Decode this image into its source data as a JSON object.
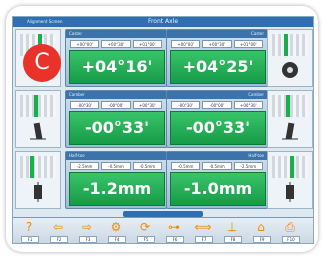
{
  "badge": "C",
  "titlebar": {
    "left_text": "Alignment Screen",
    "title": "Front Axle"
  },
  "rows": [
    {
      "name": "caster",
      "left": {
        "label": "Caster",
        "ticks": [
          "+00°00'",
          "+00°30'",
          "+01°00'"
        ],
        "value": "+04°16'"
      },
      "right": {
        "label": "Caster",
        "ticks": [
          "+00°00'",
          "+00°30'",
          "+01°00'"
        ],
        "value": "+04°25'"
      }
    },
    {
      "name": "camber",
      "left": {
        "label": "Camber",
        "ticks": [
          "-00°30'",
          "-00°00'",
          "+00°30'"
        ],
        "value": "-00°33'"
      },
      "right": {
        "label": "Camber",
        "ticks": [
          "-00°30'",
          "-00°00'",
          "+00°30'"
        ],
        "value": "-00°33'"
      }
    },
    {
      "name": "toe",
      "left": {
        "label": "Half-toe",
        "ticks": [
          "-2.5mm",
          "-0.5mm",
          "-0.5mm"
        ],
        "value": "-1.2mm"
      },
      "right": {
        "label": "Half-toe",
        "ticks": [
          "-0.5mm",
          "-0.5mm",
          "-2.5mm"
        ],
        "value": "-1.0mm"
      }
    }
  ],
  "toolbar": {
    "strip_label": "",
    "buttons": [
      {
        "name": "help",
        "glyph": "?",
        "key": "F1"
      },
      {
        "name": "back",
        "glyph": "⇦",
        "key": "F2"
      },
      {
        "name": "forward",
        "glyph": "⇨",
        "key": "F3"
      },
      {
        "name": "steering",
        "glyph": "⚙",
        "key": "F4"
      },
      {
        "name": "caster-sweep",
        "glyph": "⟳",
        "key": "F5"
      },
      {
        "name": "axle",
        "glyph": "⊶",
        "key": "F6"
      },
      {
        "name": "measure",
        "glyph": "⟺",
        "key": "F7"
      },
      {
        "name": "adjust",
        "glyph": "⊥",
        "key": "F8"
      },
      {
        "name": "live",
        "glyph": "⌂",
        "key": "F9"
      },
      {
        "name": "print",
        "glyph": "⎙",
        "key": "F10"
      }
    ]
  },
  "colors": {
    "value_green": "#1fa84f",
    "header_blue": "#2f6fb0",
    "badge_red": "#e8322a"
  }
}
